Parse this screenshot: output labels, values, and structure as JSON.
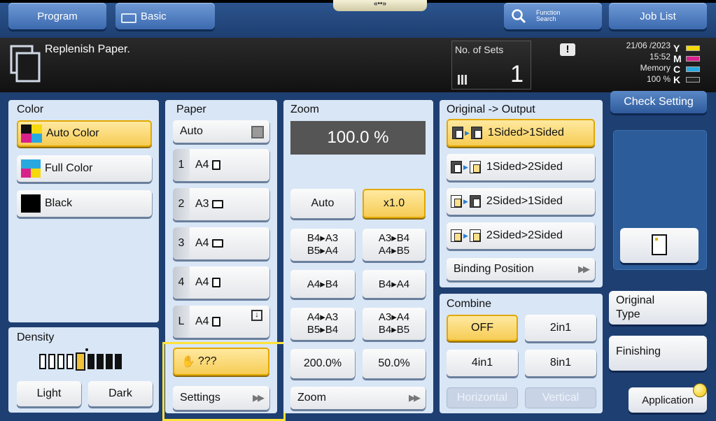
{
  "top": {
    "program": "Program",
    "basic": "Basic",
    "notch": "«••»",
    "function_search_1": "Function",
    "function_search_2": "Search",
    "job_list": "Job List"
  },
  "status": {
    "message": "Replenish Paper.",
    "sets_label": "No. of Sets",
    "sets_value": "1",
    "date": "21/06 /2023",
    "time": "15:52",
    "memory_label": "Memory",
    "memory_value": "100 %",
    "toner": [
      "Y",
      "M",
      "C",
      "K"
    ],
    "toner_colors": [
      "#f5d90a",
      "#d9218c",
      "#29a8e0",
      "#222222"
    ]
  },
  "color": {
    "title": "Color",
    "auto": "Auto Color",
    "full": "Full Color",
    "black": "Black"
  },
  "density": {
    "title": "Density",
    "light": "Light",
    "dark": "Dark",
    "level": 5,
    "levels": 9
  },
  "paper": {
    "title": "Paper",
    "auto": "Auto",
    "trays": [
      {
        "num": "1",
        "size": "A4"
      },
      {
        "num": "2",
        "size": "A3"
      },
      {
        "num": "3",
        "size": "A4"
      },
      {
        "num": "4",
        "size": "A4"
      },
      {
        "num": "L",
        "size": "A4"
      }
    ],
    "unknown": "???",
    "settings": "Settings"
  },
  "zoom": {
    "title": "Zoom",
    "value": "100.0 %",
    "auto": "Auto",
    "x1": "x1.0",
    "b4a3": "B4▸A3",
    "b5a4": "B5▸A4",
    "a3b4": "A3▸B4",
    "a4b5": "A4▸B5",
    "a4b4": "A4▸B4",
    "b4a4": "B4▸A4",
    "a4a3": "A4▸A3",
    "b5b4": "B5▸B4",
    "a3a4": "A3▸A4",
    "b4b5": "B4▸B5",
    "z200": "200.0%",
    "z50": "50.0%",
    "zoom": "Zoom"
  },
  "orig": {
    "title": "Original -> Output",
    "s11": "1Sided>1Sided",
    "s12": "1Sided>2Sided",
    "s21": "2Sided>1Sided",
    "s22": "2Sided>2Sided",
    "binding": "Binding Position"
  },
  "combine": {
    "title": "Combine",
    "off": "OFF",
    "c2": "2in1",
    "c4": "4in1",
    "c8": "8in1",
    "horizontal": "Horizontal",
    "vertical": "Vertical"
  },
  "right": {
    "check": "Check Setting",
    "original_type_1": "Original",
    "original_type_2": "Type",
    "finishing": "Finishing",
    "application": "Application"
  }
}
